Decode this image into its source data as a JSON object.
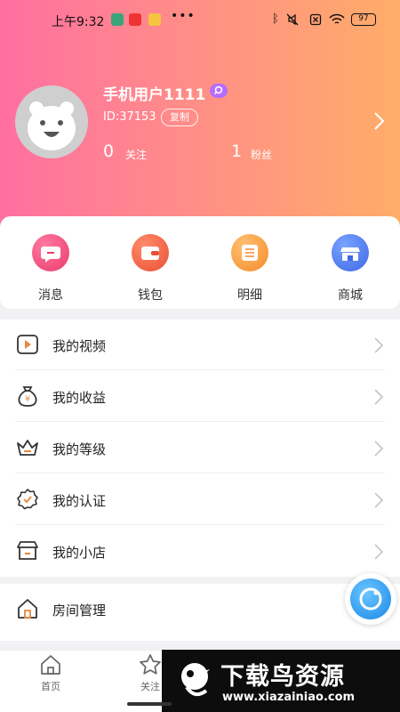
{
  "status_bar": {
    "time": "上午9:32",
    "battery": "97"
  },
  "profile": {
    "username": "手机用户1111",
    "uid": "ID:37153",
    "copy_label": "复制",
    "following_count": "0",
    "following_label": "关注",
    "fans_count": "1",
    "fans_label": "粉丝"
  },
  "quick_actions": [
    {
      "label": "消息",
      "icon": "message-icon",
      "color": "#f0457a"
    },
    {
      "label": "钱包",
      "icon": "wallet-icon",
      "color": "#f2613f"
    },
    {
      "label": "明细",
      "icon": "list-icon",
      "color": "#f7963a"
    },
    {
      "label": "商城",
      "icon": "store-icon",
      "color": "#4a78ee"
    }
  ],
  "menu": [
    {
      "label": "我的视频",
      "icon": "video-icon"
    },
    {
      "label": "我的收益",
      "icon": "money-bag-icon"
    },
    {
      "label": "我的等级",
      "icon": "crown-icon"
    },
    {
      "label": "我的认证",
      "icon": "verified-badge-icon"
    },
    {
      "label": "我的小店",
      "icon": "shop-icon"
    }
  ],
  "room_management": {
    "label": "房间管理",
    "icon": "home-icon"
  },
  "bottom_nav": [
    {
      "label": "首页",
      "icon": "home-icon"
    },
    {
      "label": "关注",
      "icon": "star-icon"
    }
  ],
  "watermark": {
    "title": "下载鸟资源",
    "url": "www.xiazainiao.com"
  },
  "colors": {
    "accent": "#e8873a",
    "gradient_start": "#ff6fa1",
    "gradient_end": "#ffad68"
  }
}
